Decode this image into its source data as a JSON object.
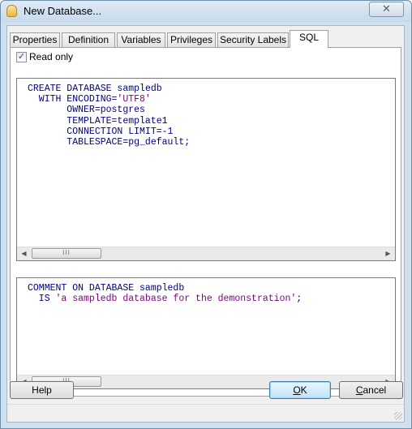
{
  "window": {
    "title": "New Database...",
    "close_label": "✕"
  },
  "tabs": [
    {
      "label": "Properties"
    },
    {
      "label": "Definition"
    },
    {
      "label": "Variables"
    },
    {
      "label": "Privileges"
    },
    {
      "label": "Security Labels"
    },
    {
      "label": "SQL",
      "active": true
    }
  ],
  "sql_tab": {
    "read_only_label": "Read only",
    "read_only_checked": true,
    "create_sql": [
      [
        {
          "t": "CREATE DATABASE",
          "c": "kw"
        },
        {
          "t": " sampledb",
          "c": "kw"
        }
      ],
      [
        {
          "t": "  WITH ENCODING=",
          "c": "kw"
        },
        {
          "t": "'UTF8'",
          "c": "str"
        }
      ],
      [
        {
          "t": "       OWNER=postgres",
          "c": "kw"
        }
      ],
      [
        {
          "t": "       TEMPLATE=template1",
          "c": "kw"
        }
      ],
      [
        {
          "t": "       CONNECTION LIMIT=",
          "c": "kw"
        },
        {
          "t": "-1",
          "c": "kw"
        }
      ],
      [
        {
          "t": "       TABLESPACE=pg_default;",
          "c": "kw"
        }
      ]
    ],
    "comment_sql": [
      [
        {
          "t": "COMMENT ON DATABASE sampledb",
          "c": "kw"
        }
      ],
      [
        {
          "t": "  IS ",
          "c": "kw"
        },
        {
          "t": "'a sampledb database for the demonstration'",
          "c": "str"
        },
        {
          "t": ";",
          "c": "kw"
        }
      ]
    ]
  },
  "buttons": {
    "help": "Help",
    "ok_mnemonic": "O",
    "ok_rest": "K",
    "cancel_mnemonic": "C",
    "cancel_rest": "ancel"
  },
  "icons": {
    "scroll_left": "◀",
    "scroll_right": "▶",
    "scroll_thumb_grip": "III",
    "checkmark": "✓"
  },
  "colors": {
    "sql_keyword": "#00007f",
    "sql_string": "#7f007f",
    "title_bar": "#c7daec"
  }
}
